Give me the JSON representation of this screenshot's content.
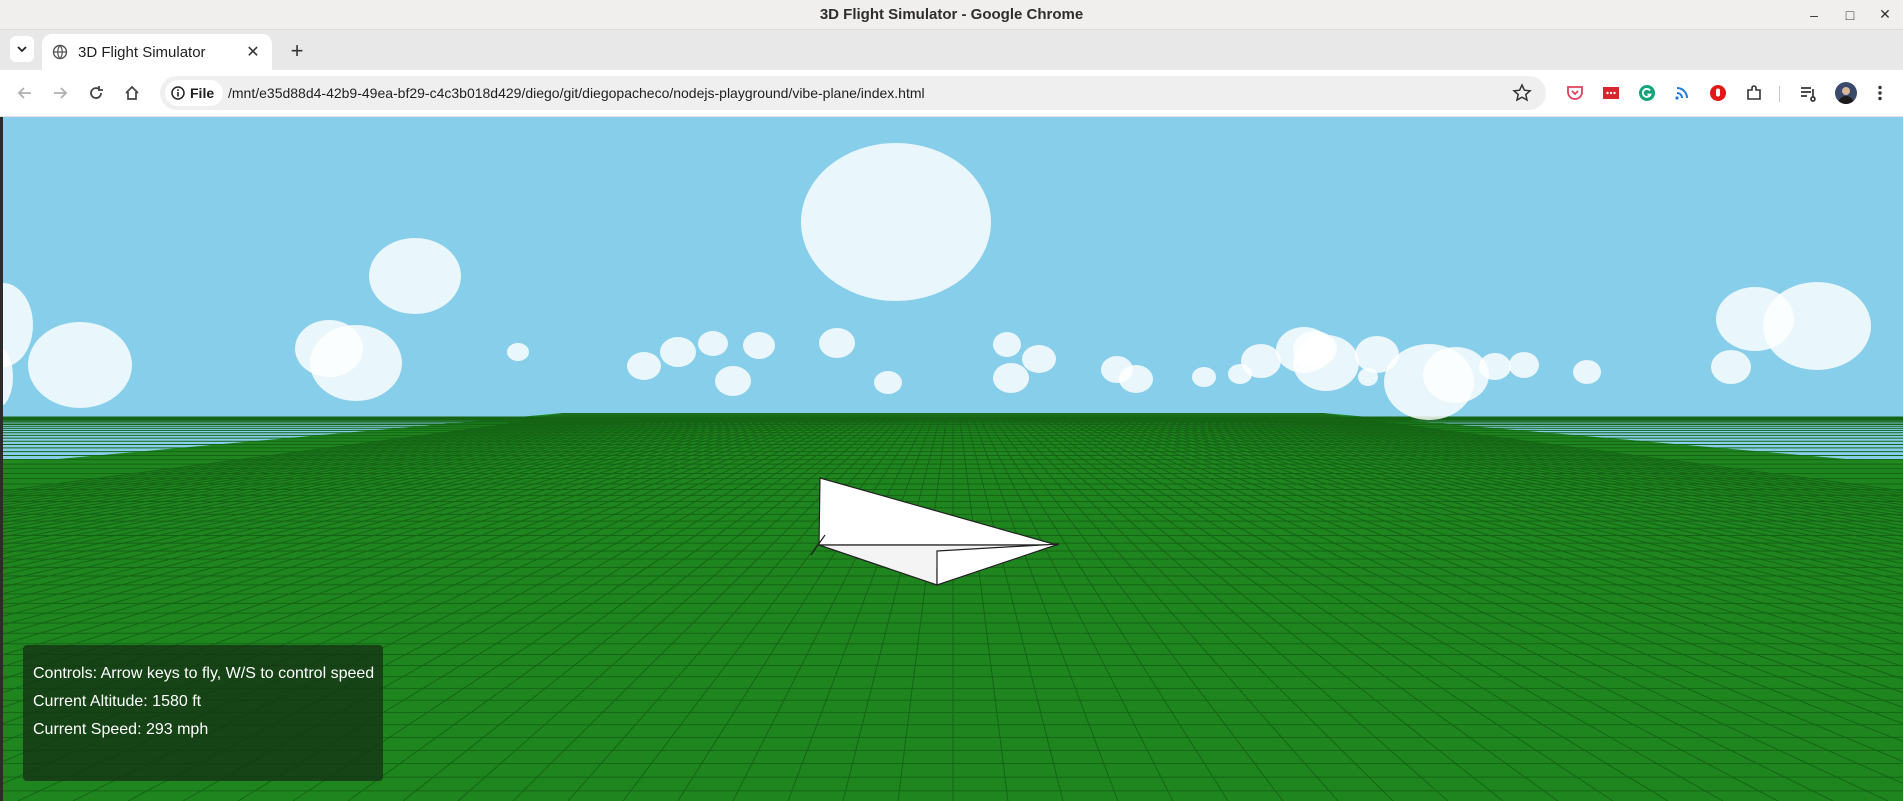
{
  "window": {
    "title": "3D Flight Simulator - Google Chrome"
  },
  "tabs": [
    {
      "label": "3D Flight Simulator"
    }
  ],
  "addressbar": {
    "scheme_label": "File",
    "url": "/mnt/e35d88d4-42b9-49ea-bf29-c4c3b018d429/diego/git/diegopacheco/nodejs-playground/vibe-plane/index.html"
  },
  "toolbar_icons": [
    "back-arrow-icon",
    "forward-arrow-icon",
    "reload-icon",
    "home-icon",
    "info-icon",
    "star-icon",
    "pocket-icon",
    "ext-red-icon",
    "grammarly-icon",
    "wireless-icon",
    "ext-stop-icon",
    "puzzle-icon",
    "media-queue-icon",
    "menu-kebab-icon"
  ],
  "colors": {
    "sky": "#87ceea",
    "ground": "#228b22",
    "grid": "#156415",
    "plane": "#ffffff"
  },
  "hud": {
    "controls": "Controls: Arrow keys to fly, W/S to control speed",
    "altitude": "Current Altitude: 1580 ft",
    "speed": "Current Speed: 293 mph"
  }
}
